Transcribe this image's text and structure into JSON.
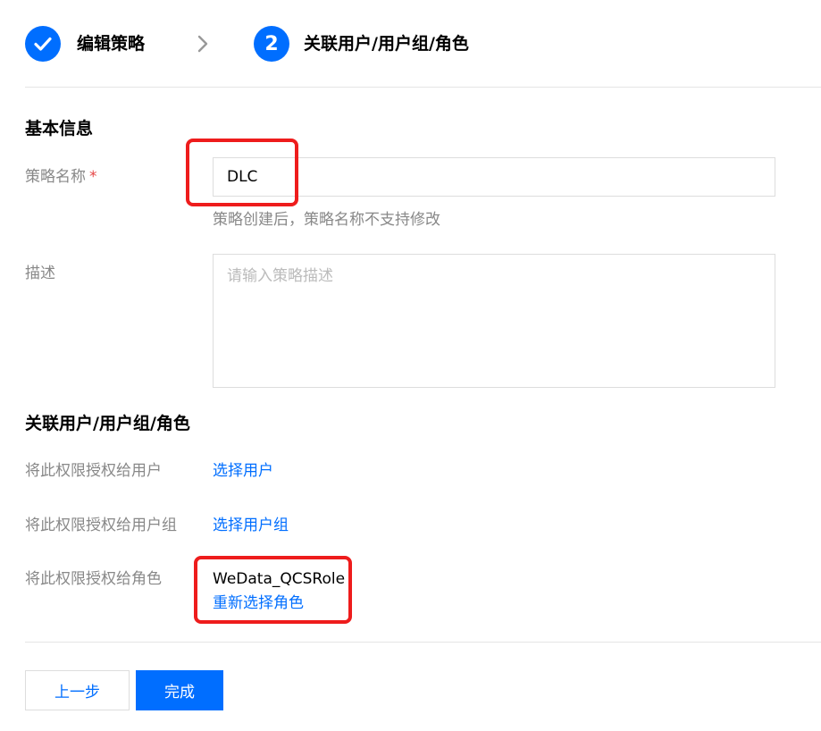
{
  "steps": [
    {
      "label": "编辑策略",
      "state": "completed",
      "icon": "check-icon"
    },
    {
      "number": "2",
      "label": "关联用户/用户组/角色",
      "state": "active"
    }
  ],
  "step_separator_icon": "chevron-right-icon",
  "basic_info": {
    "title": "基本信息",
    "policy_name": {
      "label": "策略名称",
      "required_mark": "*",
      "value": "DLC",
      "hint": "策略创建后，策略名称不支持修改"
    },
    "description": {
      "label": "描述",
      "placeholder": "请输入策略描述",
      "value": ""
    }
  },
  "associate": {
    "title": "关联用户/用户组/角色",
    "user": {
      "label": "将此权限授权给用户",
      "action": "选择用户"
    },
    "group": {
      "label": "将此权限授权给用户组",
      "action": "选择用户组"
    },
    "role": {
      "label": "将此权限授权给角色",
      "selected": "WeData_QCSRole",
      "action": "重新选择角色"
    }
  },
  "footer": {
    "prev_label": "上一步",
    "finish_label": "完成"
  },
  "colors": {
    "primary": "#006eff",
    "highlight": "#ee1c1c",
    "label": "#888888"
  }
}
